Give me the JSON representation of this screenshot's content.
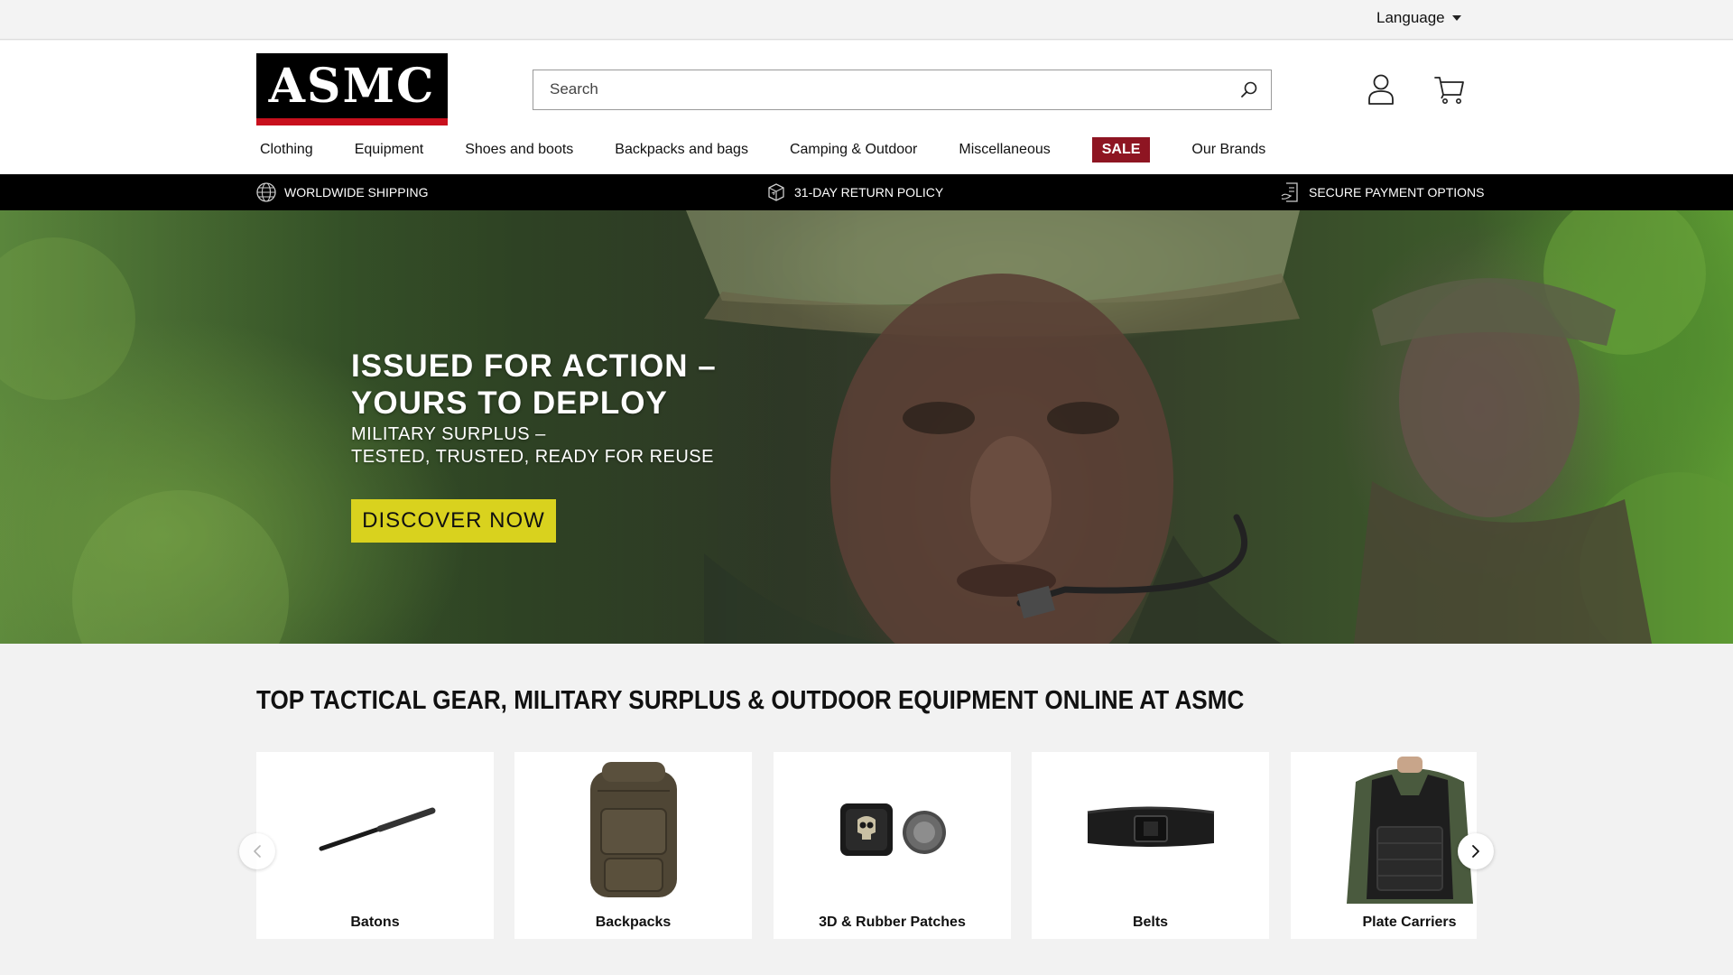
{
  "topbar": {
    "language_label": "Language"
  },
  "header": {
    "logo_text": "ASMC",
    "search": {
      "placeholder": "Search",
      "value": ""
    }
  },
  "nav": {
    "items": [
      {
        "label": "Clothing"
      },
      {
        "label": "Equipment"
      },
      {
        "label": "Shoes and boots"
      },
      {
        "label": "Backpacks and bags"
      },
      {
        "label": "Camping & Outdoor"
      },
      {
        "label": "Miscellaneous"
      },
      {
        "label": "SALE"
      },
      {
        "label": "Our Brands"
      }
    ]
  },
  "usp": [
    {
      "label": "WORLDWIDE SHIPPING",
      "icon": "globe-icon"
    },
    {
      "label": "31-DAY RETURN POLICY",
      "icon": "return-box-icon"
    },
    {
      "label": "SECURE PAYMENT OPTIONS",
      "icon": "secure-payment-icon"
    }
  ],
  "hero": {
    "title_line1": "ISSUED FOR ACTION –",
    "title_line2": "YOURS TO DEPLOY",
    "subtitle_line1": "MILITARY SURPLUS –",
    "subtitle_line2": "TESTED, TRUSTED, READY FOR REUSE",
    "cta_label": "DISCOVER NOW"
  },
  "section": {
    "title": "TOP TACTICAL GEAR, MILITARY SURPLUS & OUTDOOR EQUIPMENT ONLINE AT ASMC"
  },
  "categories": [
    {
      "label": "Batons"
    },
    {
      "label": "Backpacks"
    },
    {
      "label": "3D & Rubber Patches"
    },
    {
      "label": "Belts"
    },
    {
      "label": "Plate Carriers"
    }
  ],
  "colors": {
    "sale_bg": "#8e1522",
    "cta_bg": "#d9d21e",
    "logo_stripe": "#c8101d",
    "usp_bar_bg": "#000000"
  }
}
